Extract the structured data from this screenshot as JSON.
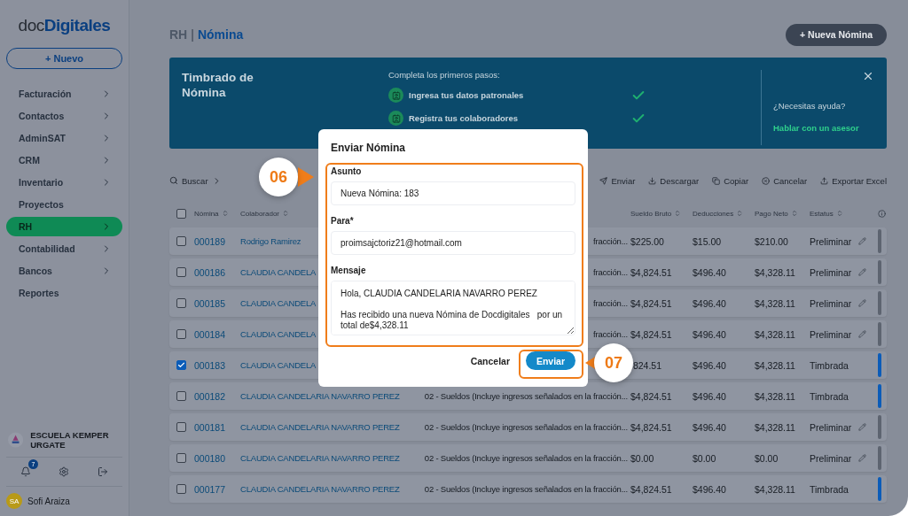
{
  "logo": {
    "plain": "doc",
    "bold": "Digitales"
  },
  "new_button": {
    "icon": "+",
    "label": "Nuevo"
  },
  "sidebar": {
    "items": [
      {
        "label": "Facturación",
        "selected": false,
        "expandable": true
      },
      {
        "label": "Contactos",
        "selected": false,
        "expandable": true
      },
      {
        "label": "AdminSAT",
        "selected": false,
        "expandable": true
      },
      {
        "label": "CRM",
        "selected": false,
        "expandable": true
      },
      {
        "label": "Inventario",
        "selected": false,
        "expandable": true
      },
      {
        "label": "Proyectos",
        "selected": false,
        "expandable": false
      },
      {
        "label": "RH",
        "selected": true,
        "expandable": true
      },
      {
        "label": "Contabilidad",
        "selected": false,
        "expandable": true
      },
      {
        "label": "Bancos",
        "selected": false,
        "expandable": true
      },
      {
        "label": "Reportes",
        "selected": false,
        "expandable": false
      }
    ],
    "company": "ESCUELA KEMPER URGATE",
    "notifications": "7",
    "user": {
      "initials": "SA",
      "name": "Sofi Araiza"
    }
  },
  "breadcrumb": {
    "section": "RH",
    "separator": "|",
    "page": "Nómina"
  },
  "new_payroll_button": {
    "icon": "+",
    "label": "Nueva Nómina"
  },
  "banner": {
    "title": "Timbrado de Nómina",
    "steps_title": "Completa los primeros pasos:",
    "steps": [
      {
        "label": "Ingresa tus datos patronales",
        "done": true
      },
      {
        "label": "Registra tus colaboradores",
        "done": true
      }
    ],
    "help": "¿Necesitas ayuda?",
    "help_link": "Hablar con un asesor"
  },
  "toolbar": {
    "search": "Buscar",
    "actions": [
      "Enviar",
      "Descargar",
      "Copiar",
      "Cancelar",
      "Exportar Excel"
    ]
  },
  "table": {
    "all_selected": false,
    "columns": [
      "Nómina",
      "Colaborador",
      "Sueldo Bruto",
      "Deducciones",
      "Pago Neto",
      "Estatus"
    ],
    "rows": [
      {
        "nomina": "000189",
        "colaborador": "Rodrigo Ramirez",
        "column_3": "fracción...",
        "sueldo_bruto": "$225.00",
        "deducciones": "$15.00",
        "pago_neto": "$210.00",
        "estatus": "Preliminar",
        "selected": false,
        "editable": true,
        "color": "#5d6470"
      },
      {
        "nomina": "000186",
        "colaborador": "CLAUDIA CANDELA",
        "column_3": "fracción...",
        "sueldo_bruto": "$4,824.51",
        "deducciones": "$496.40",
        "pago_neto": "$4,328.11",
        "estatus": "Preliminar",
        "selected": false,
        "editable": true,
        "color": "#5d6470"
      },
      {
        "nomina": "000185",
        "colaborador": "CLAUDIA CANDELA",
        "column_3": "fracción...",
        "sueldo_bruto": "$4,824.51",
        "deducciones": "$496.40",
        "pago_neto": "$4,328.11",
        "estatus": "Preliminar",
        "selected": false,
        "editable": true,
        "color": "#5d6470"
      },
      {
        "nomina": "000184",
        "colaborador": "CLAUDIA CANDELA",
        "column_3": "fracción...",
        "sueldo_bruto": "$4,824.51",
        "deducciones": "$496.40",
        "pago_neto": "$4,328.11",
        "estatus": "Preliminar",
        "selected": false,
        "editable": true,
        "color": "#5d6470"
      },
      {
        "nomina": "000183",
        "colaborador": "CLAUDIA CANDELA",
        "sueldo_bruto": ",824.51",
        "deducciones": "$496.40",
        "pago_neto": "$4,328.11",
        "estatus": "Timbrada",
        "selected": true,
        "editable": false,
        "color": "#0b5cb8"
      },
      {
        "nomina": "000182",
        "colaborador": "CLAUDIA CANDELARIA NAVARRO PEREZ",
        "column_3": "02 - Sueldos (Incluye ingresos señalados en la fracción...",
        "sueldo_bruto": "$4,824.51",
        "deducciones": "$496.40",
        "pago_neto": "$4,328.11",
        "estatus": "Timbrada",
        "selected": false,
        "editable": false,
        "color": "#0b5cb8"
      },
      {
        "nomina": "000181",
        "colaborador": "CLAUDIA CANDELARIA NAVARRO PEREZ",
        "column_3": "02 - Sueldos (Incluye ingresos señalados en la fracción...",
        "sueldo_bruto": "$4,824.51",
        "deducciones": "$496.40",
        "pago_neto": "$4,328.11",
        "estatus": "Preliminar",
        "selected": false,
        "editable": true,
        "color": "#5d6470"
      },
      {
        "nomina": "000180",
        "colaborador": "CLAUDIA CANDELARIA NAVARRO PEREZ",
        "column_3": "02 - Sueldos (Incluye ingresos señalados en la fracción...",
        "sueldo_bruto": "$0.00",
        "deducciones": "$0.00",
        "pago_neto": "$0.00",
        "estatus": "Preliminar",
        "selected": false,
        "editable": true,
        "color": "#5d6470"
      },
      {
        "nomina": "000177",
        "colaborador": "CLAUDIA CANDELARIA NAVARRO PEREZ",
        "column_3": "02 - Sueldos (Incluye ingresos señalados en la fracción...",
        "sueldo_bruto": "$4,824.51",
        "deducciones": "$496.40",
        "pago_neto": "$4,328.11",
        "estatus": "Timbrada",
        "selected": false,
        "editable": false,
        "color": "#0b5cb8"
      }
    ]
  },
  "dialog": {
    "title": "Enviar Nómina",
    "fields": [
      {
        "label": "Asunto",
        "kind": "input",
        "value": "Nueva Nómina: 183"
      },
      {
        "label": "Para*",
        "kind": "input",
        "value": "proimsajctoriz21@hotmail.com"
      },
      {
        "label": "Mensaje",
        "kind": "textarea",
        "value": "Hola, CLAUDIA CANDELARIA NAVARRO PEREZ\n\nHas recibido una nueva Nómina de Docdigitales   por un total de$4,328.11"
      }
    ],
    "cancel": "Cancelar",
    "submit": "Enviar"
  },
  "callouts": [
    "06",
    "07"
  ]
}
